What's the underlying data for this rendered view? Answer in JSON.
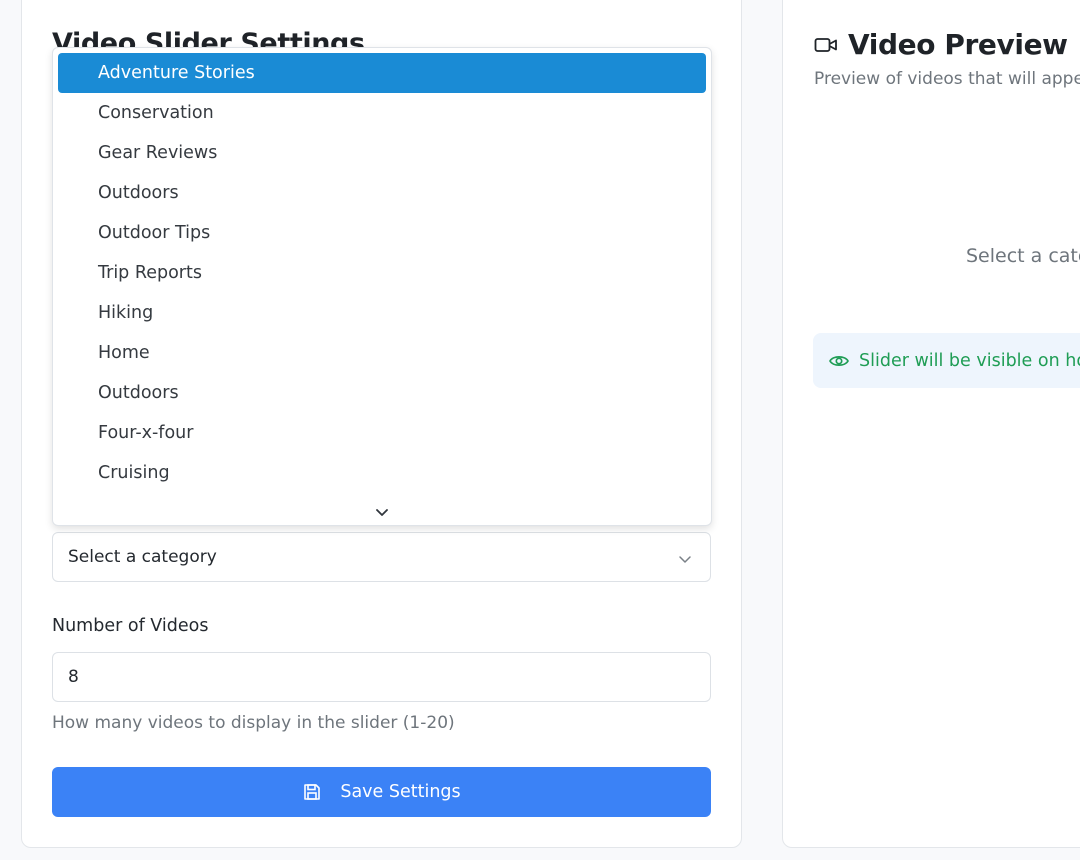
{
  "settings": {
    "title": "Video Slider Settings",
    "category_select": {
      "value": "Select a category",
      "options": [
        "Adventure Stories",
        "Conservation",
        "Gear Reviews",
        "Outdoors",
        "Outdoor Tips",
        "Trip Reports",
        "Hiking",
        "Home",
        "Outdoors",
        "Four-x-four",
        "Cruising"
      ],
      "highlighted_option": "Adventure Stories"
    },
    "number_of_videos": {
      "label": "Number of Videos",
      "value": "8",
      "help": "How many videos to display in the slider (1-20)"
    },
    "save_label": "Save Settings"
  },
  "preview": {
    "title": "Video Preview",
    "subtitle": "Preview of videos that will appea",
    "empty_message": "Select a cate",
    "visibility_message": "Slider will be visible on hom"
  },
  "colors": {
    "primary_button": "#3b82f6",
    "highlight": "#1a8bd5",
    "success_text": "#1f9d55",
    "banner_bg": "#eef5fd"
  },
  "icons": {
    "save": "save-icon",
    "video": "video-camera-icon",
    "eye": "eye-icon",
    "chevron": "chevron-down-icon"
  }
}
